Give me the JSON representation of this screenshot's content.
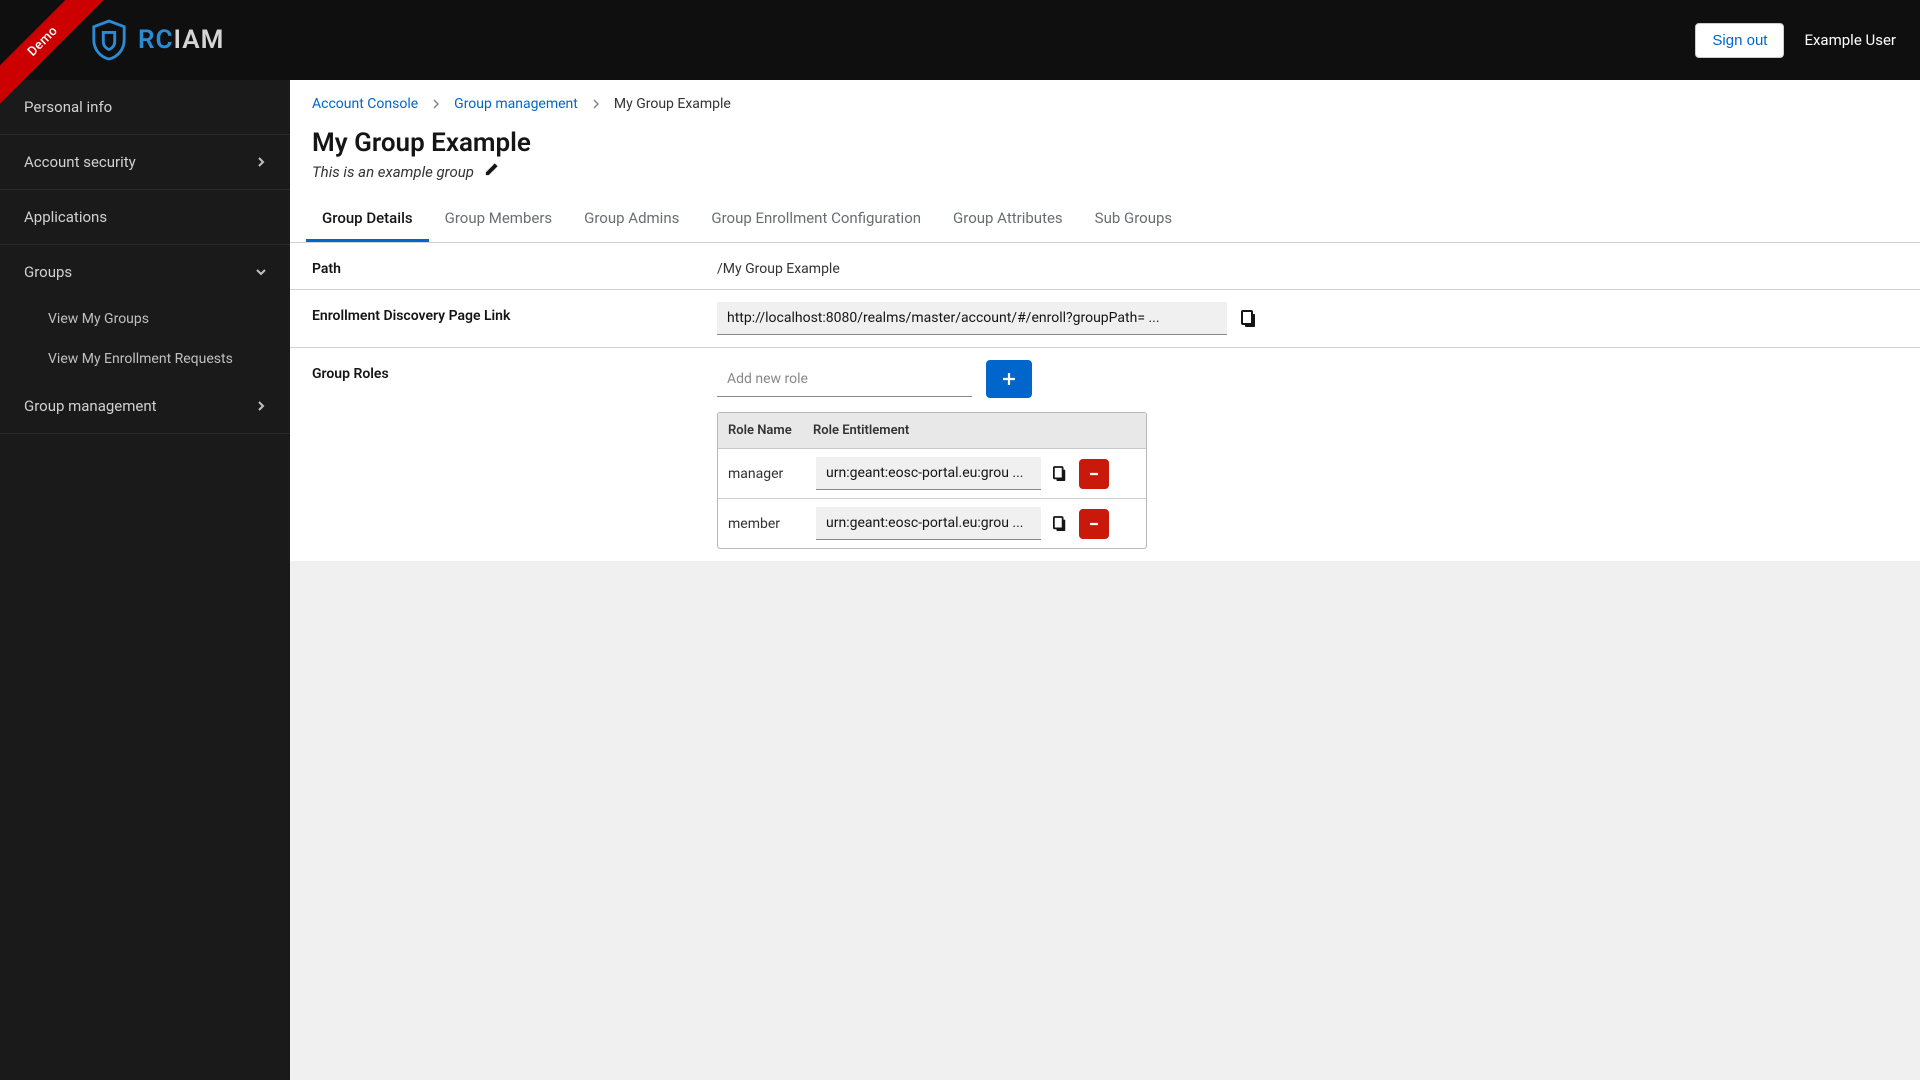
{
  "header": {
    "demo_label": "Demo",
    "logo_rc": "RC",
    "logo_iam": "IAM",
    "signout": "Sign out",
    "user": "Example User"
  },
  "sidebar": {
    "items": [
      {
        "label": "Personal info",
        "expandable": false
      },
      {
        "label": "Account security",
        "expandable": true,
        "open": false
      },
      {
        "label": "Applications",
        "expandable": false
      },
      {
        "label": "Groups",
        "expandable": true,
        "open": true,
        "children": [
          {
            "label": "View My Groups"
          },
          {
            "label": "View My Enrollment Requests"
          }
        ]
      },
      {
        "label": "Group management",
        "expandable": true,
        "open": false
      }
    ]
  },
  "breadcrumb": {
    "items": [
      {
        "label": "Account Console",
        "link": true
      },
      {
        "label": "Group management",
        "link": true
      },
      {
        "label": "My Group Example",
        "link": false
      }
    ]
  },
  "page": {
    "title": "My Group Example",
    "description": "This is an example group"
  },
  "tabs": [
    {
      "label": "Group Details",
      "active": true
    },
    {
      "label": "Group Members",
      "active": false
    },
    {
      "label": "Group Admins",
      "active": false
    },
    {
      "label": "Group Enrollment Configuration",
      "active": false
    },
    {
      "label": "Group Attributes",
      "active": false
    },
    {
      "label": "Sub Groups",
      "active": false
    }
  ],
  "details": {
    "path_label": "Path",
    "path_value": "/My Group Example",
    "enroll_label": "Enrollment Discovery Page Link",
    "enroll_value": "http://localhost:8080/realms/master/account/#/enroll?groupPath= ...",
    "roles_label": "Group Roles",
    "add_role_placeholder": "Add new role",
    "role_table": {
      "col1": "Role Name",
      "col2": "Role Entitlement",
      "rows": [
        {
          "name": "manager",
          "entitlement": "urn:geant:eosc-portal.eu:grou ..."
        },
        {
          "name": "member",
          "entitlement": "urn:geant:eosc-portal.eu:grou ..."
        }
      ]
    }
  }
}
